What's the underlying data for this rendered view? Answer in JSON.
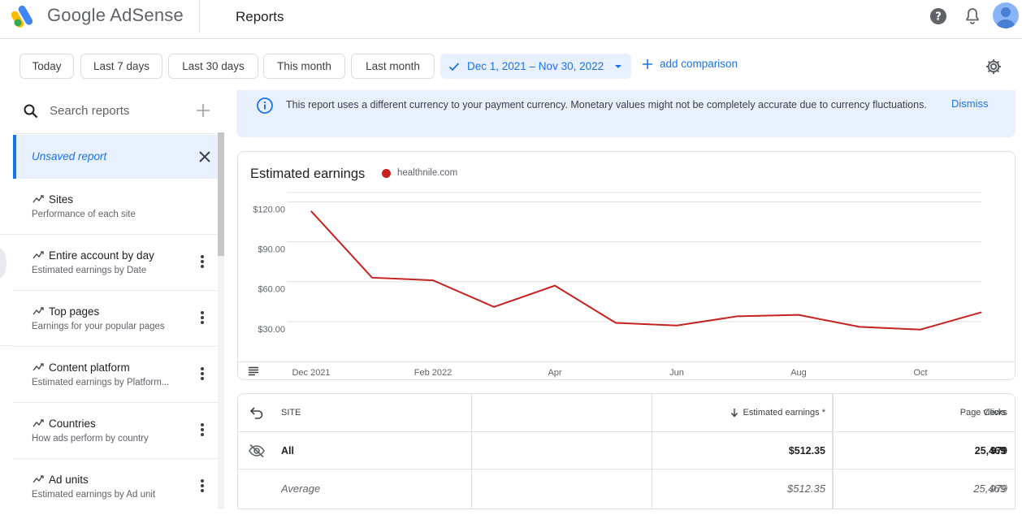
{
  "header": {
    "brand": "Google AdSense",
    "section": "Reports",
    "icons": [
      "help-icon",
      "notifications-bell-icon",
      "account-avatar"
    ]
  },
  "filters": {
    "chips": [
      "Today",
      "Last 7 days",
      "Last 30 days",
      "This month",
      "Last month"
    ],
    "date_range": "Dec 1, 2021 – Nov 30, 2022",
    "add_comparison": "add comparison"
  },
  "sidebar": {
    "search_placeholder": "Search reports",
    "unsaved": "Unsaved report",
    "items": [
      {
        "title": "Sites",
        "sub": "Performance of each site"
      },
      {
        "title": "Entire account by day",
        "sub": "Estimated earnings by Date"
      },
      {
        "title": "Top pages",
        "sub": "Earnings for your popular pages"
      },
      {
        "title": "Content platform",
        "sub": "Estimated earnings by Platform..."
      },
      {
        "title": "Countries",
        "sub": "How ads perform by country"
      },
      {
        "title": "Ad units",
        "sub": "Estimated earnings by Ad unit"
      }
    ]
  },
  "banner": {
    "message": "This report uses a different currency to your payment currency. Monetary values might not be completely accurate due to currency fluctuations.",
    "dismiss": "Dismiss"
  },
  "chart_data": {
    "type": "line",
    "title": "Estimated earnings",
    "x": [
      "Dec 2021",
      "Jan 2022",
      "Feb 2022",
      "Mar 2022",
      "Apr",
      "May 2022",
      "Jun",
      "Jul 2022",
      "Aug",
      "Sep 2022",
      "Oct",
      "Nov 2022"
    ],
    "x_tick_labels": [
      "Dec 2021",
      "Feb 2022",
      "Apr",
      "Jun",
      "Aug",
      "Oct"
    ],
    "series": [
      {
        "name": "healthnile.com",
        "color": "#c5221f",
        "values": [
          113,
          63,
          61,
          41,
          57,
          29,
          27,
          34,
          35,
          26,
          24,
          37
        ]
      }
    ],
    "y_tick_labels": [
      "$30.00",
      "$60.00",
      "$90.00",
      "$120.00"
    ],
    "y_ticks": [
      30,
      60,
      90,
      120
    ],
    "ylim": [
      0,
      127
    ],
    "grid": true
  },
  "table": {
    "columns": [
      "SITE",
      "Estimated earnings *",
      "Page views",
      "Clicks"
    ],
    "rows": [
      {
        "site": "All",
        "earnings": "$512.35",
        "views": "25,469",
        "clicks": "979"
      },
      {
        "site": "Average",
        "earnings": "$512.35",
        "views": "25,469",
        "clicks": "979"
      }
    ]
  },
  "colors": {
    "accent": "#1a73e8",
    "series": "#c5221f",
    "banner_bg": "#e8f0fe"
  }
}
